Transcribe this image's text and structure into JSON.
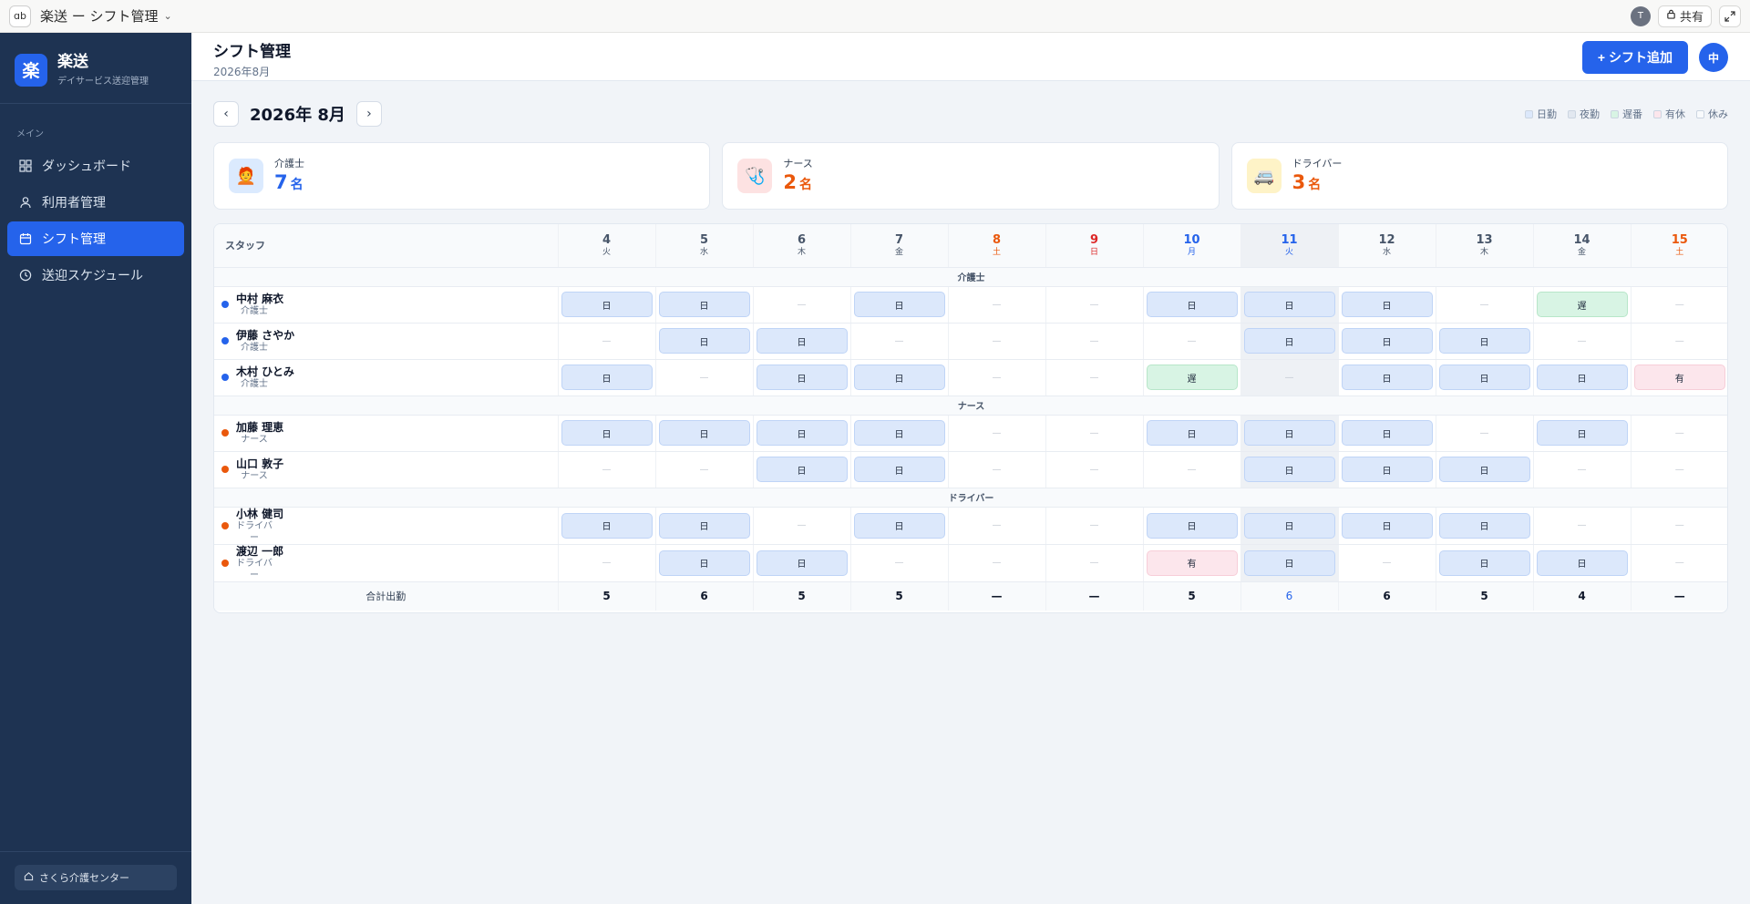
{
  "appbar": {
    "app_icon": "ɑb",
    "title": "楽送 ー シフト管理",
    "avatar": "T",
    "share_label": "共有"
  },
  "sidebar": {
    "logo": "楽",
    "brand_name": "楽送",
    "brand_sub": "デイサービス送迎管理",
    "section_label": "メイン",
    "items": [
      {
        "label": "ダッシュボード",
        "icon": "grid-icon",
        "active": false
      },
      {
        "label": "利用者管理",
        "icon": "user-icon",
        "active": false
      },
      {
        "label": "シフト管理",
        "icon": "calendar-icon",
        "active": true
      },
      {
        "label": "送迎スケジュール",
        "icon": "clock-icon",
        "active": false
      }
    ],
    "org_name": "さくら介護センター"
  },
  "header": {
    "title": "シフト管理",
    "subtitle": "2026年8月",
    "add_button": "+ シフト追加",
    "user_initial": "中"
  },
  "month": {
    "label": "2026年 8月",
    "prev": "‹",
    "next": "›",
    "legend": [
      {
        "label": "日勤",
        "color": "#dce8fb"
      },
      {
        "label": "夜勤",
        "color": "#e2e8f0"
      },
      {
        "label": "遅番",
        "color": "#d8f4e4"
      },
      {
        "label": "有休",
        "color": "#fce6ec"
      },
      {
        "label": "休み",
        "color": "#f8fafc"
      }
    ]
  },
  "cards": [
    {
      "label": "介護士",
      "value": "7",
      "unit": "名",
      "icon": "🧑‍🦰",
      "icon_bg": "#dbeafe",
      "color": "#2563eb"
    },
    {
      "label": "ナース",
      "value": "2",
      "unit": "名",
      "icon": "🩺",
      "icon_bg": "#fde2e2",
      "color": "#ea580c"
    },
    {
      "label": "ドライバー",
      "value": "3",
      "unit": "名",
      "icon": "🚐",
      "icon_bg": "#fef3c7",
      "color": "#ea580c"
    }
  ],
  "table": {
    "staff_header": "スタッフ",
    "days": [
      {
        "num": "4",
        "wk": "火",
        "type": ""
      },
      {
        "num": "5",
        "wk": "水",
        "type": ""
      },
      {
        "num": "6",
        "wk": "木",
        "type": ""
      },
      {
        "num": "7",
        "wk": "金",
        "type": ""
      },
      {
        "num": "8",
        "wk": "土",
        "type": "sat"
      },
      {
        "num": "9",
        "wk": "日",
        "type": "sun"
      },
      {
        "num": "10",
        "wk": "月",
        "type": "mon-blue"
      },
      {
        "num": "11",
        "wk": "火",
        "type": "mon-blue today"
      },
      {
        "num": "12",
        "wk": "水",
        "type": ""
      },
      {
        "num": "13",
        "wk": "木",
        "type": ""
      },
      {
        "num": "14",
        "wk": "金",
        "type": ""
      },
      {
        "num": "15",
        "wk": "土",
        "type": "sat"
      }
    ],
    "groups": [
      {
        "label": "介護士",
        "staff": [
          {
            "name": "中村 麻衣",
            "role": "介護士",
            "dot": "#2563eb",
            "shifts": [
              "日",
              "日",
              "—",
              "日",
              "—",
              "—",
              "日",
              "日",
              "日",
              "—",
              "遅",
              "—"
            ]
          },
          {
            "name": "伊藤 さやか",
            "role": "介護士",
            "dot": "#2563eb",
            "shifts": [
              "—",
              "日",
              "日",
              "—",
              "—",
              "—",
              "—",
              "日",
              "日",
              "日",
              "—",
              "—"
            ]
          },
          {
            "name": "木村 ひとみ",
            "role": "介護士",
            "dot": "#2563eb",
            "shifts": [
              "日",
              "—",
              "日",
              "日",
              "—",
              "—",
              "遅",
              "—",
              "日",
              "日",
              "日",
              "有"
            ]
          }
        ]
      },
      {
        "label": "ナース",
        "staff": [
          {
            "name": "加藤 理恵",
            "role": "ナース",
            "dot": "#ea580c",
            "shifts": [
              "日",
              "日",
              "日",
              "日",
              "—",
              "—",
              "日",
              "日",
              "日",
              "—",
              "日",
              "—"
            ]
          },
          {
            "name": "山口 敦子",
            "role": "ナース",
            "dot": "#ea580c",
            "shifts": [
              "—",
              "—",
              "日",
              "日",
              "—",
              "—",
              "—",
              "日",
              "日",
              "日",
              "—",
              "—"
            ]
          }
        ]
      },
      {
        "label": "ドライバー",
        "staff": [
          {
            "name": "小林 健司",
            "role": "ドライバー",
            "dot": "#ea580c",
            "shifts": [
              "日",
              "日",
              "—",
              "日",
              "—",
              "—",
              "日",
              "日",
              "日",
              "日",
              "—",
              "—"
            ]
          },
          {
            "name": "渡辺 一郎",
            "role": "ドライバー",
            "dot": "#ea580c",
            "shifts": [
              "—",
              "日",
              "日",
              "—",
              "—",
              "—",
              "有",
              "日",
              "—",
              "日",
              "日",
              "—"
            ]
          }
        ]
      }
    ],
    "total_label": "合計出勤",
    "totals": [
      "5",
      "6",
      "5",
      "5",
      "—",
      "—",
      "5",
      "6",
      "6",
      "5",
      "4",
      "—"
    ]
  }
}
